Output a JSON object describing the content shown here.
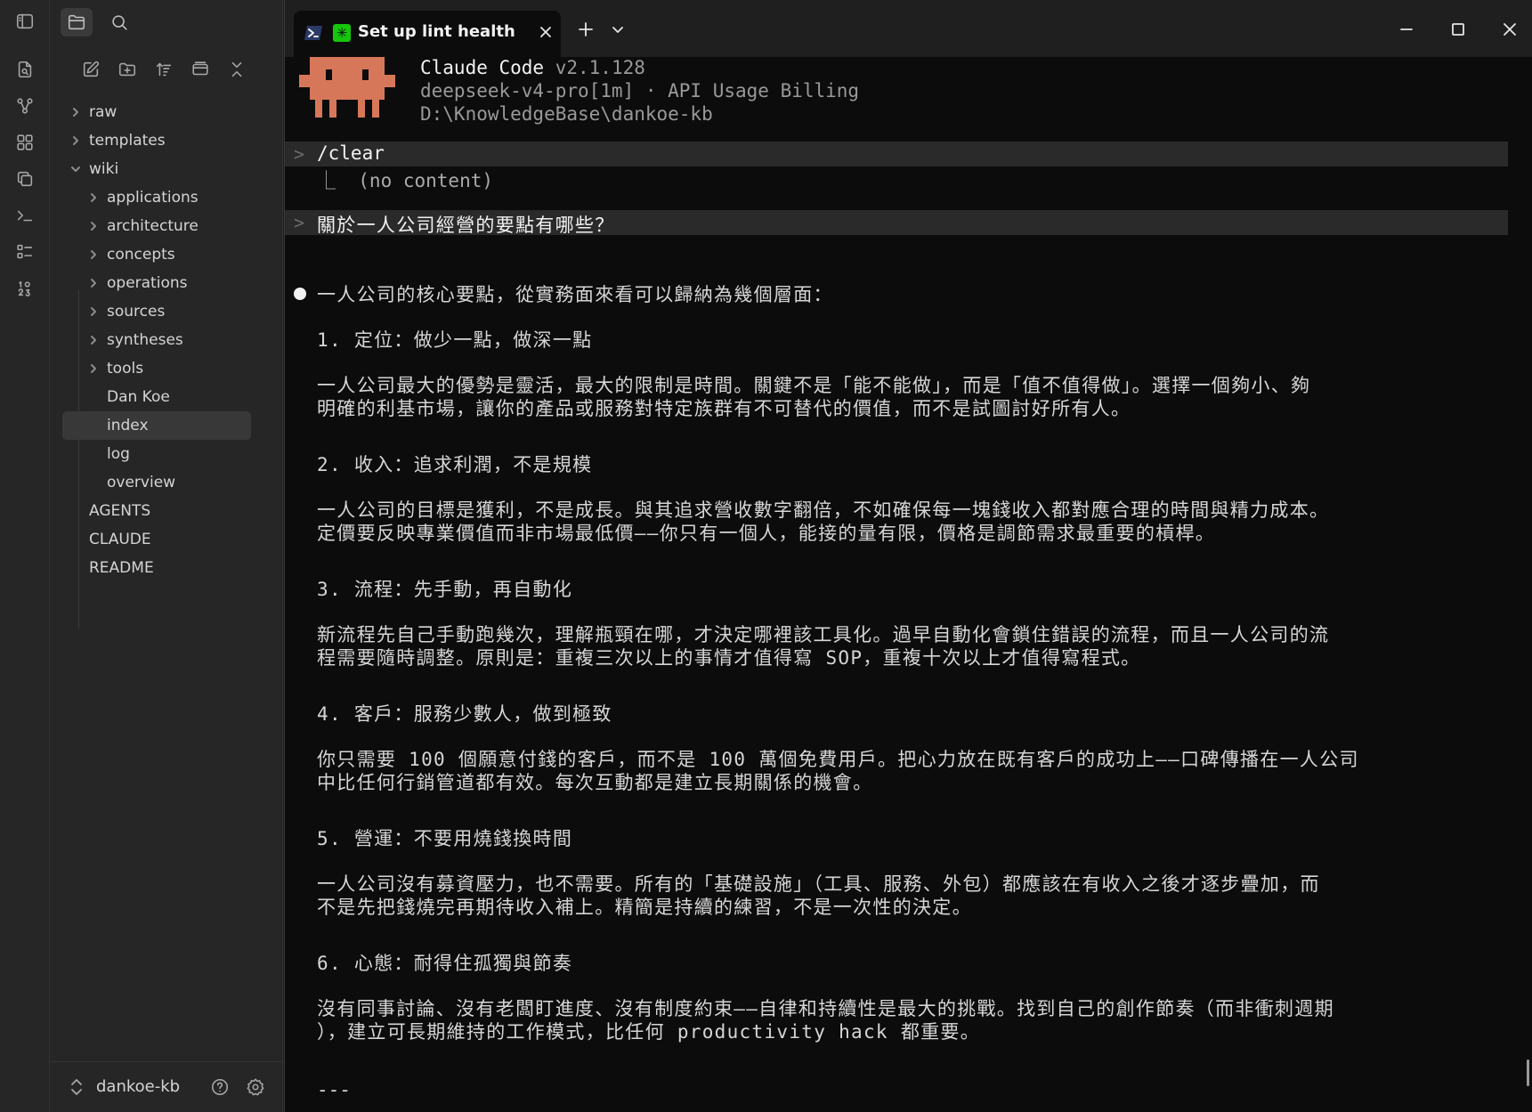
{
  "ribbon": {
    "icons": [
      "sidebar-toggle-icon",
      "open-quick-switcher-icon",
      "graph-view-icon",
      "canvas-icon",
      "templates-icon",
      "terminal-icon",
      "outline-icon",
      "bookmarks-icon"
    ]
  },
  "sidebar": {
    "top_icons": [
      "files-icon",
      "search-icon"
    ],
    "nav_icons": [
      "new-note-icon",
      "new-folder-icon",
      "sort-icon",
      "collapse-all-icon",
      "close-icon"
    ],
    "tree": [
      {
        "label": "raw",
        "type": "folder",
        "expanded": false,
        "depth": 0
      },
      {
        "label": "templates",
        "type": "folder",
        "expanded": false,
        "depth": 0
      },
      {
        "label": "wiki",
        "type": "folder",
        "expanded": true,
        "depth": 0
      },
      {
        "label": "applications",
        "type": "folder",
        "expanded": false,
        "depth": 1
      },
      {
        "label": "architecture",
        "type": "folder",
        "expanded": false,
        "depth": 1
      },
      {
        "label": "concepts",
        "type": "folder",
        "expanded": false,
        "depth": 1
      },
      {
        "label": "operations",
        "type": "folder",
        "expanded": false,
        "depth": 1
      },
      {
        "label": "sources",
        "type": "folder",
        "expanded": false,
        "depth": 1
      },
      {
        "label": "syntheses",
        "type": "folder",
        "expanded": false,
        "depth": 1
      },
      {
        "label": "tools",
        "type": "folder",
        "expanded": false,
        "depth": 1
      },
      {
        "label": "Dan Koe",
        "type": "file",
        "depth": 1
      },
      {
        "label": "index",
        "type": "file",
        "depth": 1,
        "selected": true
      },
      {
        "label": "log",
        "type": "file",
        "depth": 1
      },
      {
        "label": "overview",
        "type": "file",
        "depth": 1
      },
      {
        "label": "AGENTS",
        "type": "file",
        "depth": 0
      },
      {
        "label": "CLAUDE",
        "type": "file",
        "depth": 0
      },
      {
        "label": "README",
        "type": "file",
        "depth": 0
      }
    ],
    "vault_name": "dankoe-kb"
  },
  "terminal": {
    "tab_title": "Set up lint health check",
    "header": {
      "app": "Claude Code",
      "version": "v2.1.128",
      "model_line": "deepseek-v4-pro[1m] · API Usage Billing",
      "path": "D:\\KnowledgeBase\\dankoe-kb"
    },
    "prompt_mark": ">",
    "clear_cmd": "/clear",
    "clear_result": "⎿  (no content)",
    "question": "關於一人公司經營的要點有哪些？",
    "answer_intro": "一人公司的核心要點，從實務面來看可以歸納為幾個層面：",
    "sections": [
      {
        "heading": "1. 定位：做少一點，做深一點",
        "lines": [
          "一人公司最大的優勢是靈活，最大的限制是時間。關鍵不是「能不能做」，而是「值不值得做」。選擇一個夠小、夠",
          "明確的利基市場，讓你的產品或服務對特定族群有不可替代的價值，而不是試圖討好所有人。"
        ]
      },
      {
        "heading": "2. 收入：追求利潤，不是規模",
        "lines": [
          "一人公司的目標是獲利，不是成長。與其追求營收數字翻倍，不如確保每一塊錢收入都對應合理的時間與精力成本。",
          "定價要反映專業價值而非市場最低價——你只有一個人，能接的量有限，價格是調節需求最重要的槓桿。"
        ]
      },
      {
        "heading": "3. 流程：先手動，再自動化",
        "lines": [
          "新流程先自己手動跑幾次，理解瓶頸在哪，才決定哪裡該工具化。過早自動化會鎖住錯誤的流程，而且一人公司的流",
          "程需要隨時調整。原則是：重複三次以上的事情才值得寫 SOP，重複十次以上才值得寫程式。"
        ]
      },
      {
        "heading": "4. 客戶：服務少數人，做到極致",
        "lines": [
          "你只需要 100 個願意付錢的客戶，而不是 100 萬個免費用戶。把心力放在既有客戶的成功上——口碑傳播在一人公司",
          "中比任何行銷管道都有效。每次互動都是建立長期關係的機會。"
        ]
      },
      {
        "heading": "5. 營運：不要用燒錢換時間",
        "lines": [
          "一人公司沒有募資壓力，也不需要。所有的「基礎設施」（工具、服務、外包）都應該在有收入之後才逐步疊加，而",
          "不是先把錢燒完再期待收入補上。精簡是持續的練習，不是一次性的決定。"
        ]
      },
      {
        "heading": "6. 心態：耐得住孤獨與節奏",
        "lines": [
          "沒有同事討論、沒有老闆盯進度、沒有制度約束——自律和持續性是最大的挑戰。找到自己的創作節奏（而非衝刺週期",
          "），建立可長期維持的工作模式，比任何 productivity hack 都重要。"
        ]
      }
    ],
    "separator": "---"
  },
  "colors": {
    "mascot": "#d7775a",
    "claude_icon": "#16c60c",
    "terminal_bg": "#0c0c0c",
    "sidebar_bg": "#262626"
  }
}
